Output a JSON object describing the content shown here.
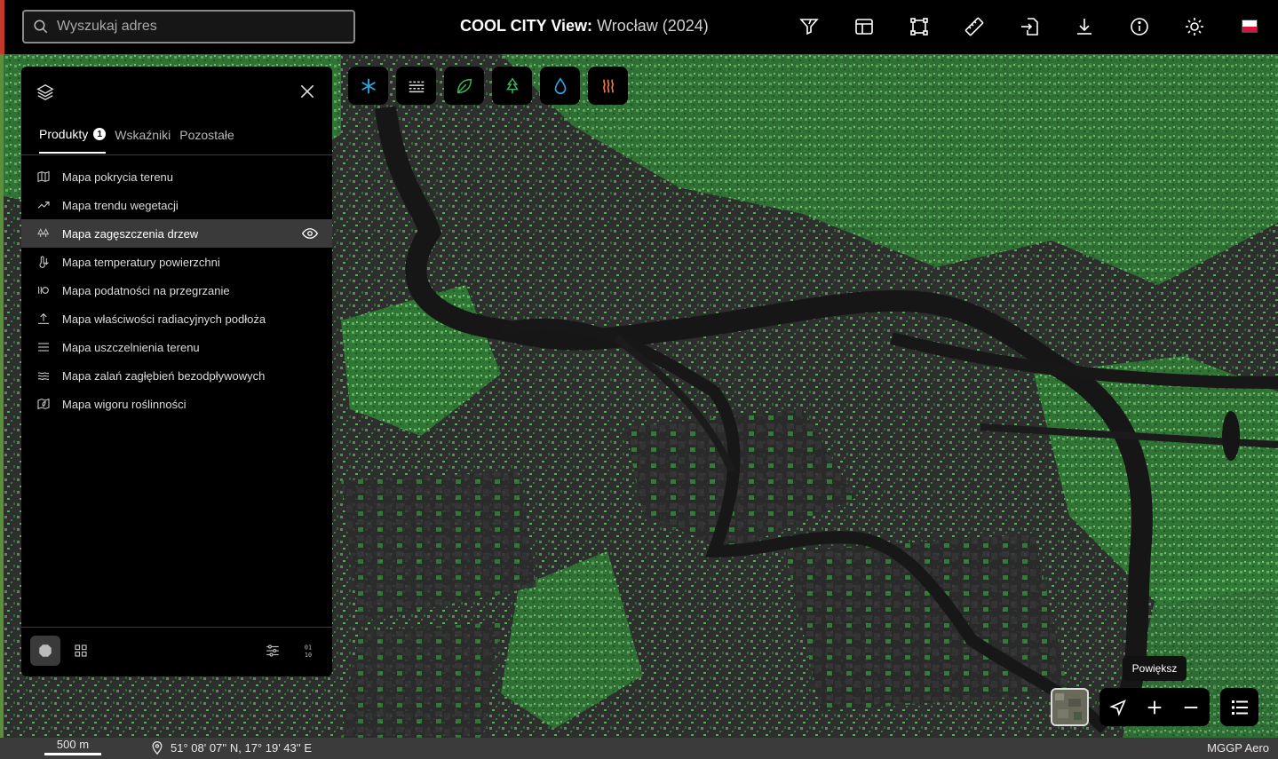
{
  "search": {
    "placeholder": "Wyszukaj adres"
  },
  "header": {
    "title_bold": "COOL CITY View:",
    "title_rest": "Wrocław (2024)"
  },
  "toolbar": {
    "icons": [
      "filter-icon",
      "layout-icon",
      "selection-frame-icon",
      "ruler-icon",
      "import-icon",
      "download-icon",
      "info-icon",
      "sun-icon"
    ],
    "language_flag": "PL"
  },
  "categories": [
    "snowflake-icon",
    "haze-icon",
    "leaf-icon",
    "tree-icon",
    "water-drop-icon",
    "heat-icon"
  ],
  "panel": {
    "tabs": [
      {
        "label": "Produkty",
        "badge": "1"
      },
      {
        "label": "Wskaźniki"
      },
      {
        "label": "Pozostałe"
      }
    ],
    "items": [
      {
        "label": "Mapa pokrycia terenu",
        "icon": "map-icon"
      },
      {
        "label": "Mapa trendu wegetacji",
        "icon": "trend-icon"
      },
      {
        "label": "Mapa zagęszczenia drzew",
        "icon": "trees-icon",
        "selected": true
      },
      {
        "label": "Mapa temperatury powierzchni",
        "icon": "thermometer-icon"
      },
      {
        "label": "Mapa podatności na przegrzanie",
        "icon": "overheat-icon"
      },
      {
        "label": "Mapa właściwości radiacyjnych podłoża",
        "icon": "radiation-icon"
      },
      {
        "label": "Mapa uszczelnienia terenu",
        "icon": "sealing-icon"
      },
      {
        "label": "Mapa zalań zagłębień bezodpływowych",
        "icon": "flood-icon"
      },
      {
        "label": "Mapa wigoru roślinności",
        "icon": "vigor-icon"
      }
    ]
  },
  "map_controls": {
    "tooltip": "Powiększ"
  },
  "statusbar": {
    "scale": "500 m",
    "coordinates": "51° 08' 07'' N, 17° 19' 43'' E",
    "attribution": "MGGP Aero"
  },
  "colors": {
    "map_green": "#3fa34d",
    "map_dark": "#2c2c2c",
    "river": "#151515",
    "accent_blue": "#2aa7e0",
    "accent_orange": "#f07a3a"
  }
}
